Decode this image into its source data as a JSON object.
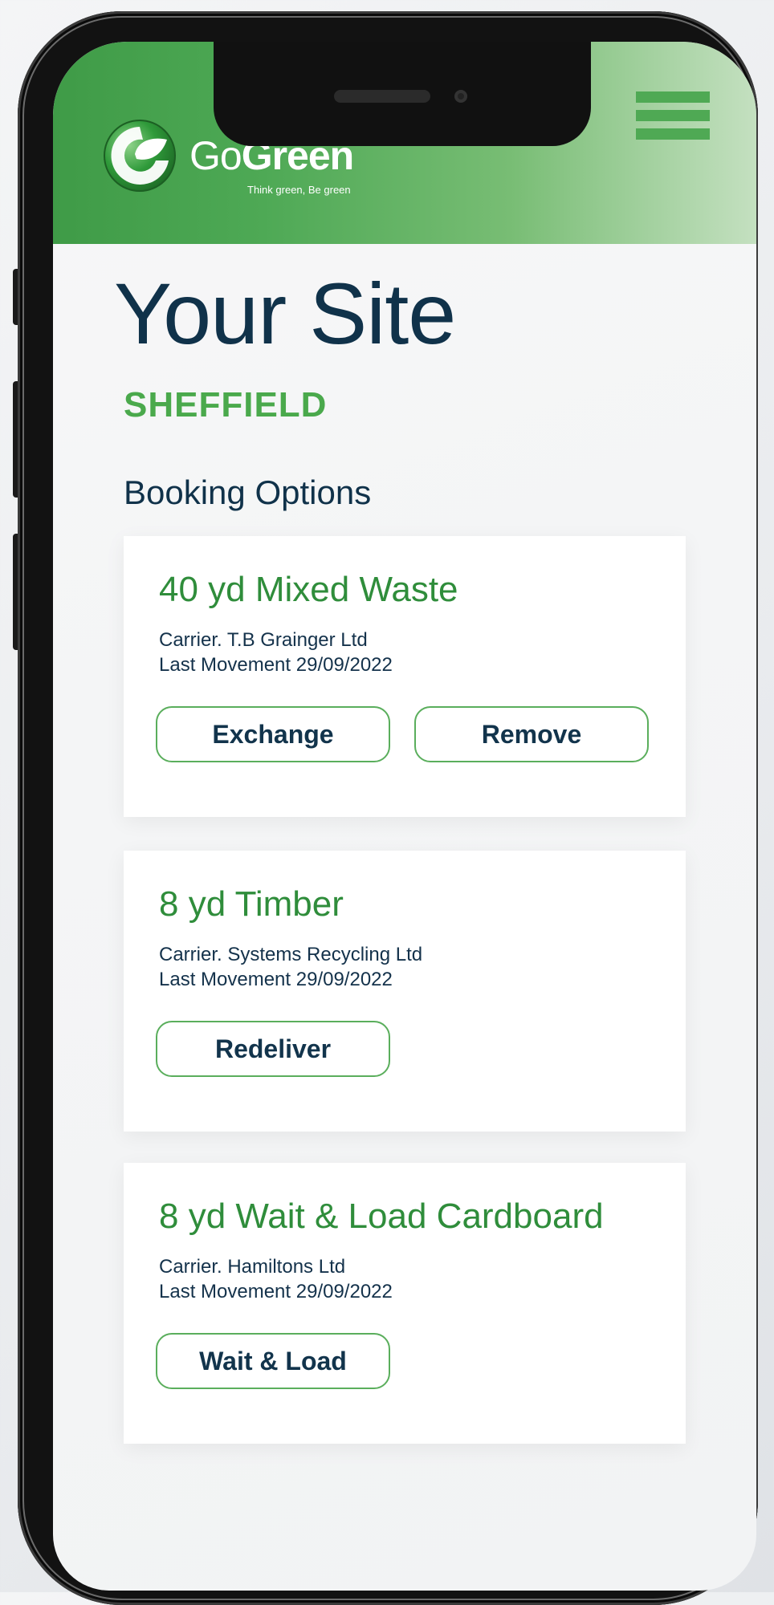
{
  "header": {
    "logo_prefix": "Go",
    "logo_bold": "Green",
    "logo_reg": "®",
    "tagline": "Think green, Be green"
  },
  "page": {
    "title": "Your Site",
    "site": "SHEFFIELD",
    "section_title": "Booking Options"
  },
  "bookings": [
    {
      "title": "40 yd Mixed Waste",
      "carrier": "Carrier. T.B Grainger Ltd",
      "last_movement": "Last Movement 29/09/2022",
      "actions": [
        "Exchange",
        "Remove"
      ]
    },
    {
      "title": "8 yd Timber",
      "carrier": "Carrier. Systems Recycling Ltd",
      "last_movement": "Last Movement 29/09/2022",
      "actions": [
        "Redeliver"
      ]
    },
    {
      "title": "8 yd Wait & Load Cardboard",
      "carrier": "Carrier. Hamiltons Ltd",
      "last_movement": "Last Movement 29/09/2022",
      "actions": [
        "Wait & Load"
      ]
    }
  ],
  "icons": {
    "logo": "gogreen-leaf-logo-icon",
    "menu": "hamburger-menu-icon"
  },
  "colors": {
    "brand_green": "#4ea955",
    "title_green": "#2f8d3b",
    "navy": "#10324a"
  }
}
